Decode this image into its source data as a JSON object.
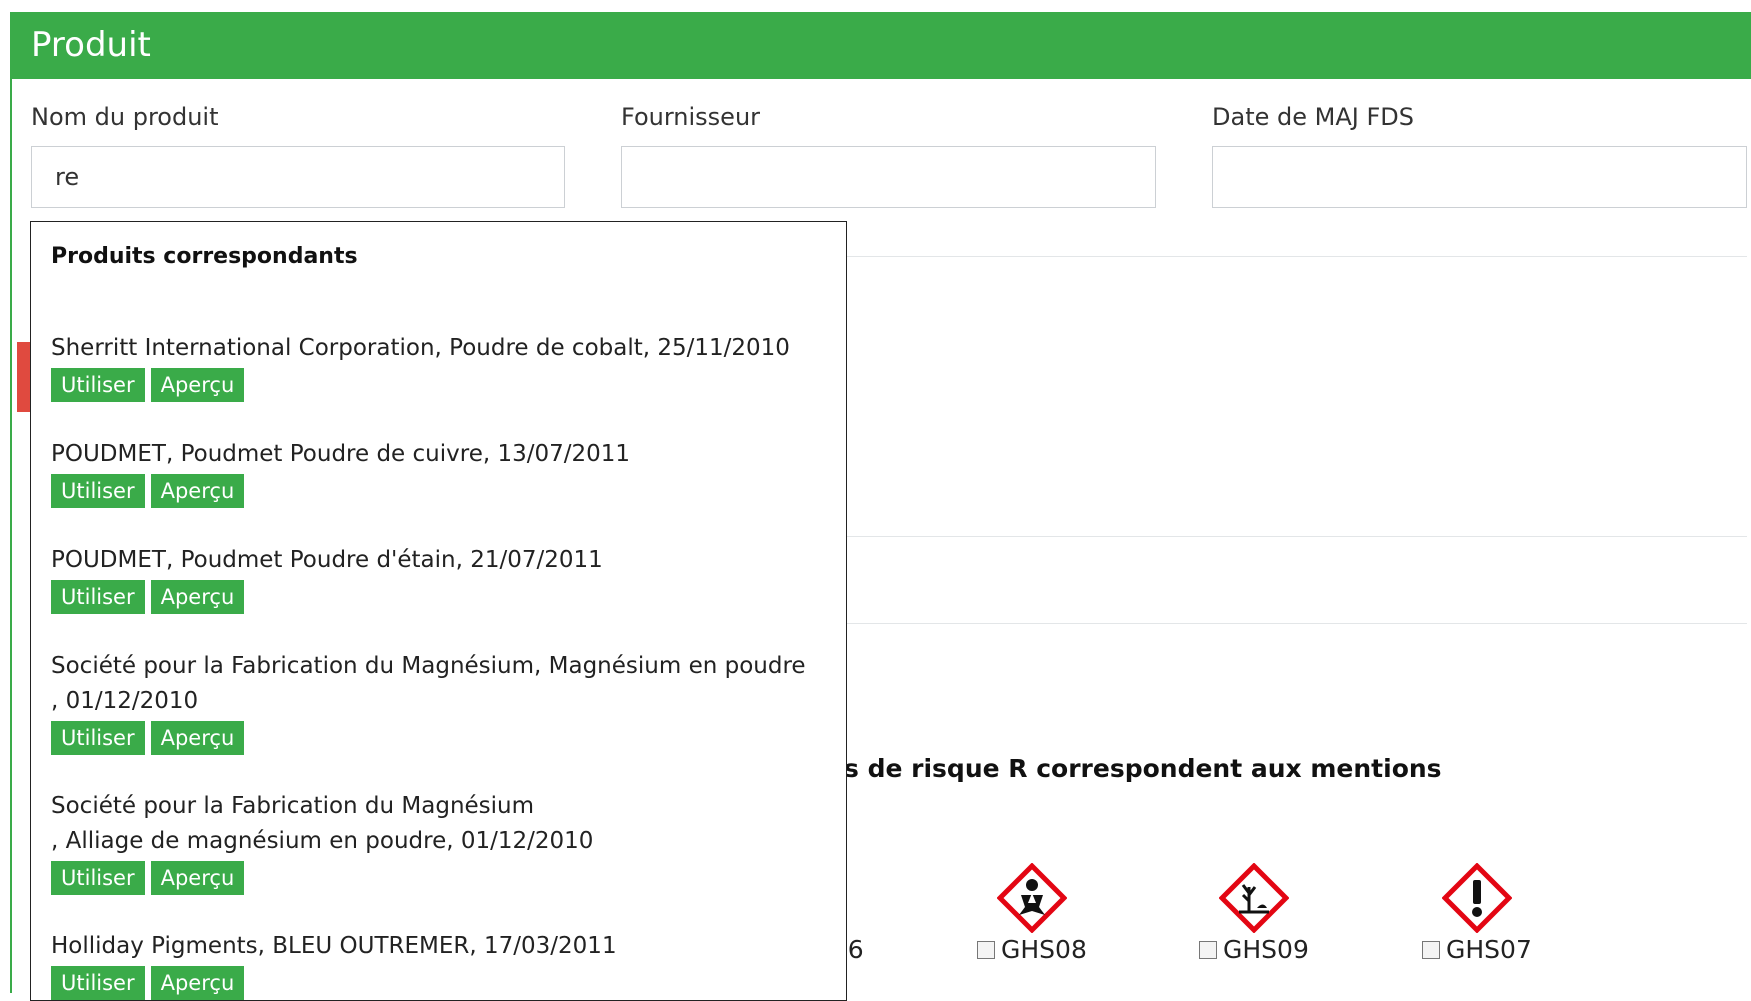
{
  "header": {
    "title": "Produit"
  },
  "form": {
    "product_name": {
      "label": "Nom du produit",
      "value": "re"
    },
    "supplier": {
      "label": "Fournisseur",
      "value": ""
    },
    "fds_date": {
      "label": "Date de MAJ FDS",
      "value": ""
    }
  },
  "dropdown": {
    "title": "Produits correspondants",
    "items": [
      {
        "text": "Sherritt International Corporation, Poudre de cobalt, 25/11/2010",
        "use_label": "Utiliser",
        "preview_label": "Aperçu"
      },
      {
        "text": "POUDMET, Poudmet Poudre de cuivre, 13/07/2011",
        "use_label": "Utiliser",
        "preview_label": "Aperçu"
      },
      {
        "text": "POUDMET, Poudmet Poudre d'étain, 21/07/2011",
        "use_label": "Utiliser",
        "preview_label": "Aperçu"
      },
      {
        "text": "Société pour la Fabrication du Magnésium, Magnésium en poudre\n, 01/12/2010",
        "use_label": "Utiliser",
        "preview_label": "Aperçu"
      },
      {
        "text": "Société pour la Fabrication du Magnésium\n, Alliage de magnésium en poudre, 01/12/2010",
        "use_label": "Utiliser",
        "preview_label": "Aperçu"
      },
      {
        "text": "Holliday Pigments, BLEU OUTREMER, 17/03/2011",
        "use_label": "Utiliser",
        "preview_label": "Aperçu"
      }
    ]
  },
  "background": {
    "risk_heading_fragment": "s de risque R correspondent aux mentions",
    "ghs_fragment": ")6",
    "pictograms": [
      {
        "label": "GHS08",
        "icon": "health-hazard-icon"
      },
      {
        "label": "GHS09",
        "icon": "environment-icon"
      },
      {
        "label": "GHS07",
        "icon": "exclamation-icon"
      }
    ]
  },
  "colors": {
    "brand_green": "#3aab49",
    "hazard_red": "#e30613",
    "accent_red": "#e04a3f"
  }
}
